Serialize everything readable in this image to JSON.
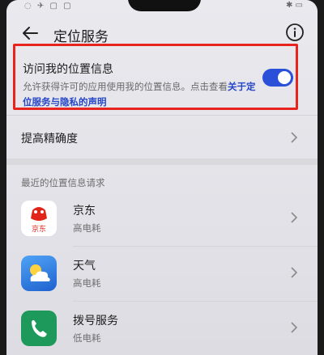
{
  "header": {
    "title": "定位服务"
  },
  "location_access": {
    "title": "访问我的位置信息",
    "description": "允许获得许可的应用使用我的位置信息。点击查看",
    "link_text": "关于定位服务与隐私的声明",
    "enabled": true
  },
  "accuracy": {
    "label": "提高精确度"
  },
  "recent_requests": {
    "header": "最近的位置信息请求",
    "apps": [
      {
        "name": "京东",
        "usage": "高电耗",
        "icon": "jd-icon",
        "icon_text": "京东",
        "color": "#e1251b"
      },
      {
        "name": "天气",
        "usage": "高电耗",
        "icon": "weather-icon",
        "color": "#2b7fe0"
      },
      {
        "name": "拨号服务",
        "usage": "低电耗",
        "icon": "phone-icon",
        "color": "#1d9a5b"
      }
    ]
  },
  "colors": {
    "toggle_on": "#2a4fd8",
    "link": "#2646c8",
    "highlight_border": "#e8241f"
  }
}
